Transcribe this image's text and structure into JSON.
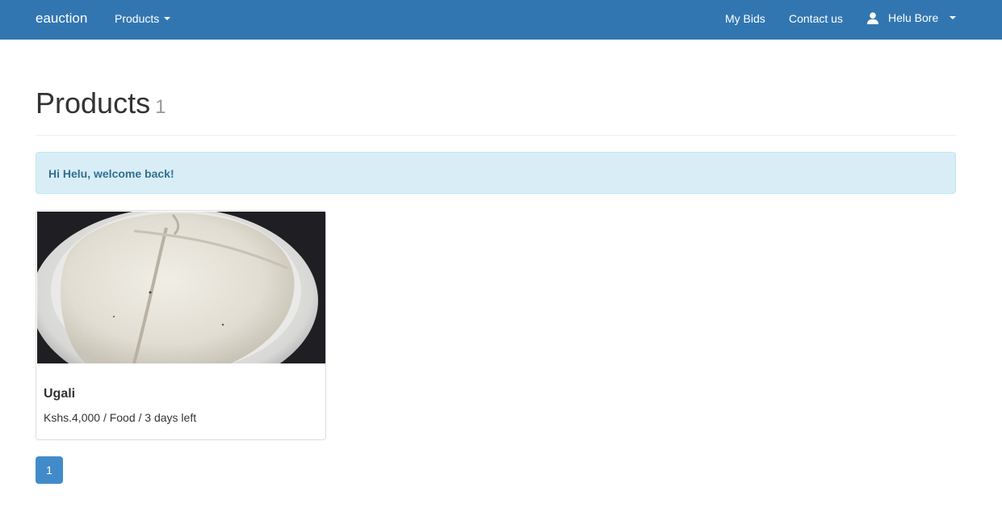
{
  "navbar": {
    "brand": "eauction",
    "products_label": "Products",
    "my_bids_label": "My Bids",
    "contact_label": "Contact us",
    "user_name": "Helu Bore",
    "colors": {
      "background": "#3276b1",
      "text": "#ffffff"
    }
  },
  "page": {
    "title": "Products",
    "count": "1"
  },
  "alert": {
    "message": "Hi Helu, welcome back!"
  },
  "products": [
    {
      "name": "Ugali",
      "meta": "Kshs.4,000 / Food / 3 days left",
      "image_icon": "food-image"
    }
  ],
  "pagination": {
    "current_page": "1"
  }
}
